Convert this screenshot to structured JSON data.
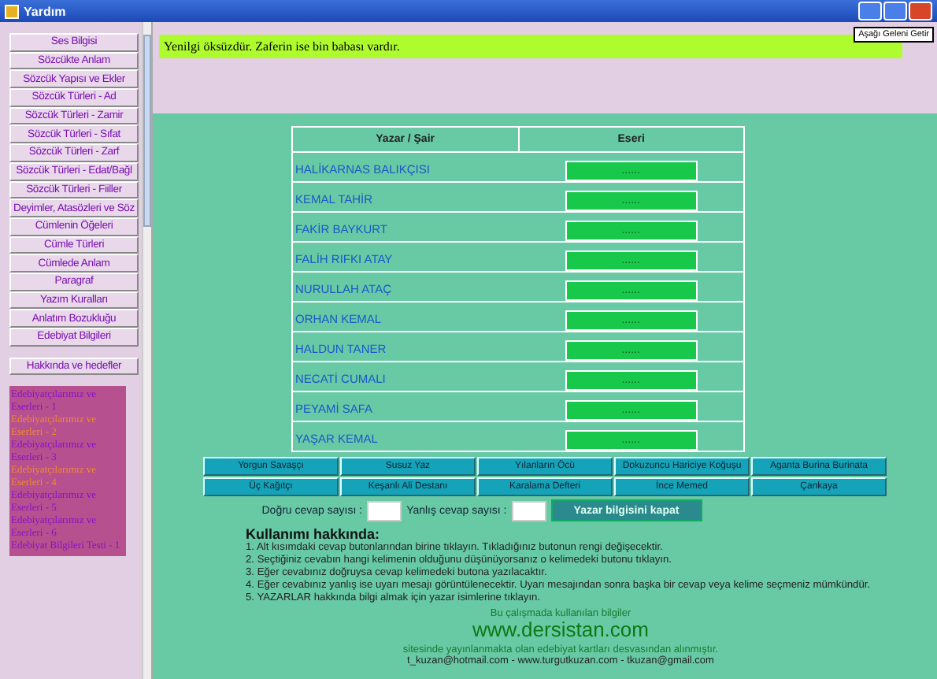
{
  "window": {
    "title": "Yardım"
  },
  "sidebar": {
    "items": [
      {
        "label": "Ses Bilgisi"
      },
      {
        "label": "Sözcükte Anlam"
      },
      {
        "label": "Sözcük Yapısı ve Ekler"
      },
      {
        "label": "Sözcük Türleri - Ad"
      },
      {
        "label": "Sözcük Türleri - Zamir"
      },
      {
        "label": "Sözcük Türleri - Sıfat"
      },
      {
        "label": "Sözcük Türleri - Zarf"
      },
      {
        "label": "Sözcük Türleri - Edat/Bağl"
      },
      {
        "label": "Sözcük Türleri - Fiiller"
      },
      {
        "label": "Deyimler, Atasözleri ve Söz"
      },
      {
        "label": "Cümlenin Öğeleri"
      },
      {
        "label": "Cümle Türleri"
      },
      {
        "label": "Cümlede Anlam"
      },
      {
        "label": "Paragraf"
      },
      {
        "label": "Yazım Kuralları"
      },
      {
        "label": "Anlatım Bozukluğu"
      },
      {
        "label": "Edebiyat Bilgileri"
      }
    ],
    "about_button": "Hakkında ve hedefler",
    "links": [
      {
        "label": "Edebiyatçılarımız ve Eserleri - 1",
        "color": "#8a10c8"
      },
      {
        "label": "Edebiyatçılarımız ve Eserleri - 2",
        "color": "#f08a30"
      },
      {
        "label": "Edebiyatçılarımız ve Eserleri - 3",
        "color": "#8a10c8"
      },
      {
        "label": "Edebiyatçılarımız ve Eserleri - 4",
        "color": "#f08a30"
      },
      {
        "label": "Edebiyatçılarımız ve Eserleri - 5",
        "color": "#8a10c8"
      },
      {
        "label": "Edebiyatçılarımız ve Eserleri - 6",
        "color": "#8a10c8"
      },
      {
        "label": "Edebiyat Bilgileri Testi - 1",
        "color": "#8a10c8"
      }
    ]
  },
  "quote": "Yenilgi öksüzdür. Zaferin ise bin babası vardır.",
  "tooltip": "Aşağı Geleni Getir",
  "table": {
    "columns": [
      "Yazar / Şair",
      "Eseri"
    ],
    "rows": [
      {
        "author": "HALİKARNAS BALIKÇISI",
        "answer": "......"
      },
      {
        "author": "KEMAL TAHİR",
        "answer": "......"
      },
      {
        "author": "FAKİR BAYKURT",
        "answer": "......"
      },
      {
        "author": "FALİH RIFKI ATAY",
        "answer": "......"
      },
      {
        "author": "NURULLAH ATAÇ",
        "answer": "......"
      },
      {
        "author": "ORHAN KEMAL",
        "answer": "......"
      },
      {
        "author": "HALDUN TANER",
        "answer": "......"
      },
      {
        "author": "NECATİ CUMALI",
        "answer": "......"
      },
      {
        "author": "PEYAMİ SAFA",
        "answer": "......"
      },
      {
        "author": "YAŞAR KEMAL",
        "answer": "......"
      }
    ]
  },
  "answer_buttons": [
    "Yorgun Savaşçı",
    "Susuz Yaz",
    "Yılanların Öcü",
    "Dokuzuncu Hariciye Koğuşu",
    "Aganta Burina Burinata",
    "Üç Kağıtçı",
    "Keşanlı Ali Destanı",
    "Karalama Defteri",
    "İnce Memed",
    "Çankaya"
  ],
  "score": {
    "correct_label": "Doğru cevap sayısı :",
    "wrong_label": "Yanlış cevap sayısı :",
    "close_button": "Yazar bilgisini kapat"
  },
  "usage": {
    "title": "Kullanımı hakkında:",
    "steps": [
      "1. Alt kısımdaki cevap butonlarından birine tıklayın. Tıkladığınız butonun rengi değişecektir.",
      "2. Seçtiğiniz cevabın hangi kelimenin olduğunu düşünüyorsanız o kelimedeki butonu tıklayın.",
      "3. Eğer cevabınız doğruysa cevap kelimedeki butona yazılacaktır.",
      "4. Eğer cevabınız yanlış ise uyarı mesajı görüntülenecektir. Uyarı mesajından sonra başka bir cevap veya kelime seçmeniz mümkündür.",
      "5. YAZARLAR hakkında bilgi almak için yazar isimlerine tıklayın."
    ],
    "credit": "Bu çalışmada kullanılan bilgiler",
    "site": "www.dersistan.com",
    "source": "sitesinde yayınlanmakta olan edebiyat kartları desvasından alınmıştır.",
    "contacts": "t_kuzan@hotmail.com - www.turgutkuzan.com - tkuzan@gmail.com"
  }
}
